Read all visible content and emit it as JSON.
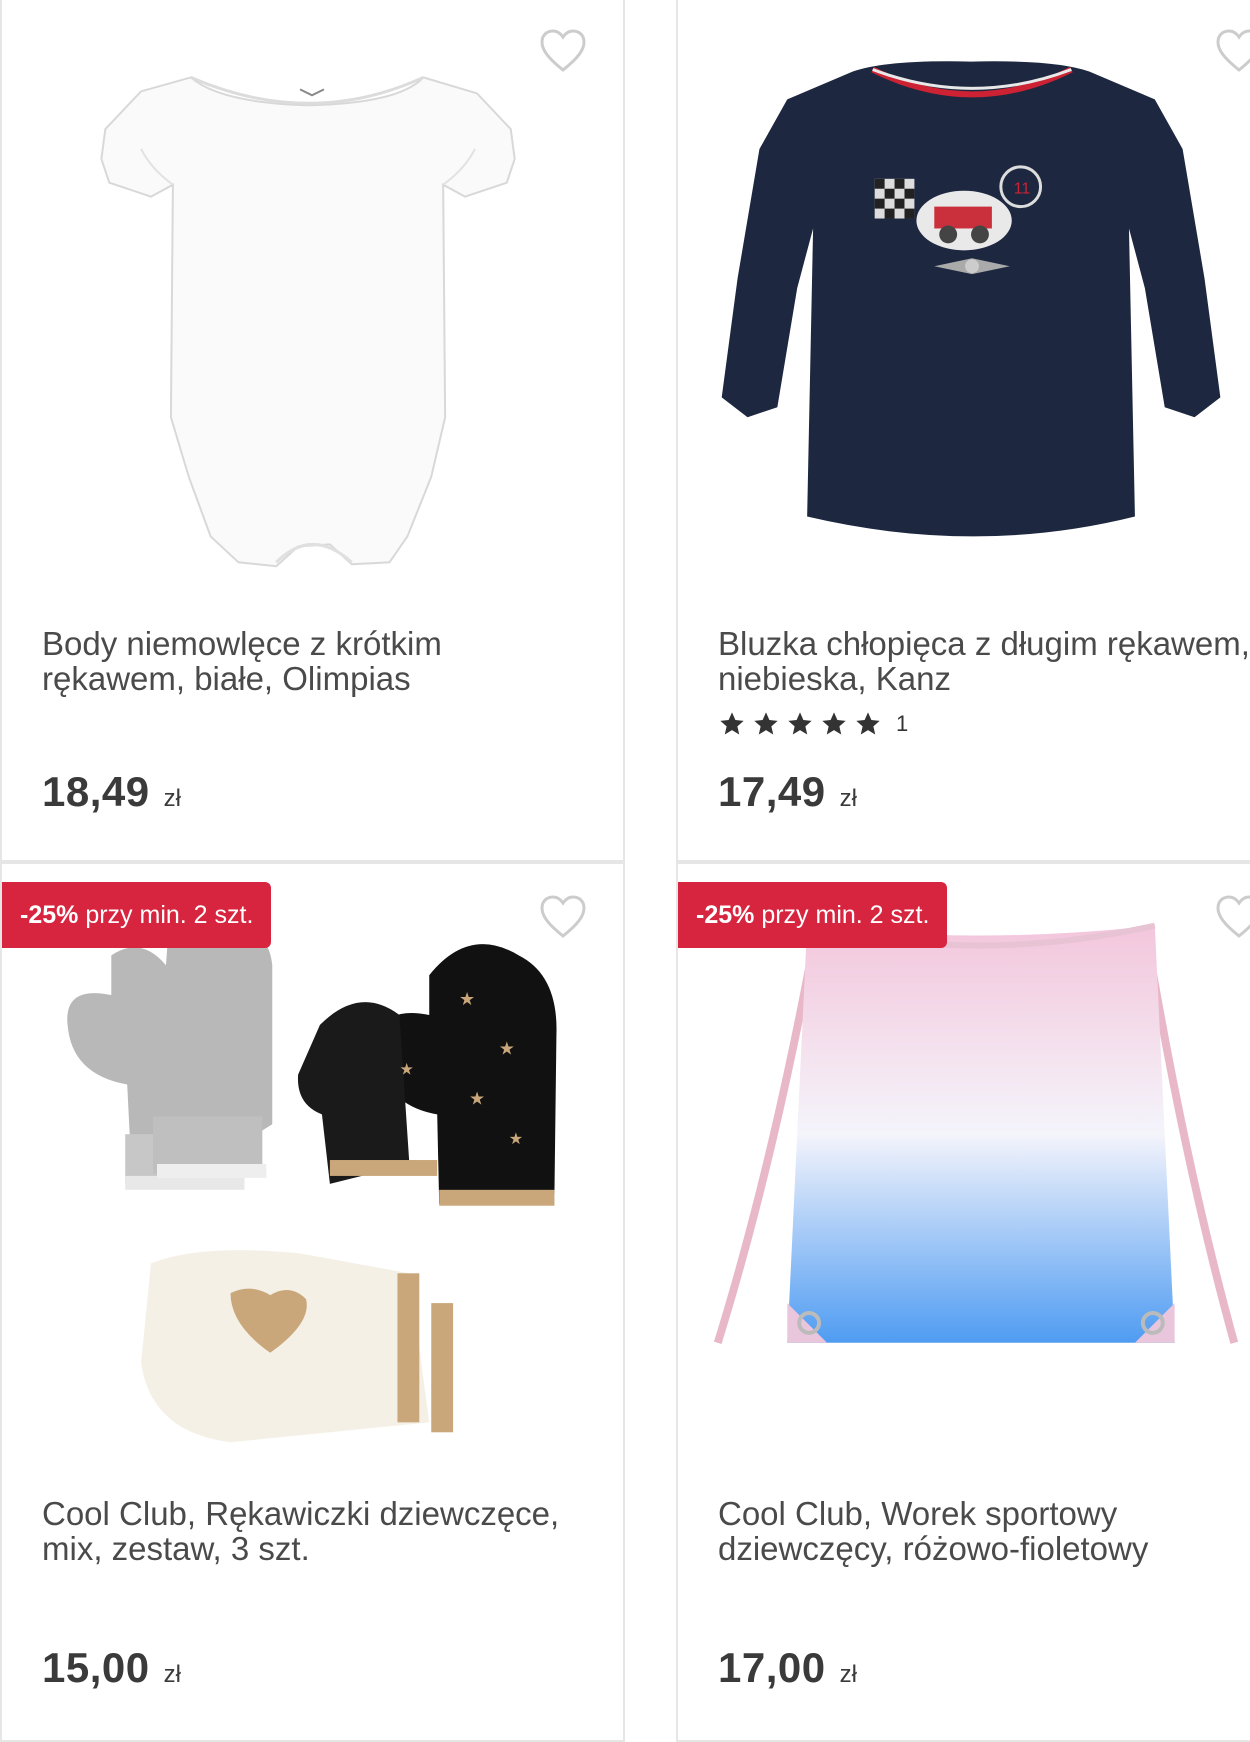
{
  "products": [
    {
      "name": "Body niemowlęce z krótkim rękawem, białe, Olimpias",
      "price": "18,49",
      "currency": "zł",
      "badge": null,
      "rating": null
    },
    {
      "name": "Bluzka chłopięca z długim rękawem, niebieska, Kanz",
      "price": "17,49",
      "currency": "zł",
      "badge": null,
      "rating": {
        "stars": 5,
        "count": "1"
      }
    },
    {
      "name": "Cool Club, Rękawiczki dziewczęce, mix, zestaw, 3 szt.",
      "price": "15,00",
      "currency": "zł",
      "badge": {
        "discount": "-25%",
        "text": " przy min. 2 szt."
      },
      "rating": null
    },
    {
      "name": "Cool Club, Worek sportowy dziewczęcy, różowo-fioletowy",
      "price": "17,00",
      "currency": "zł",
      "badge": {
        "discount": "-25%",
        "text": " przy min. 2 szt."
      },
      "rating": null
    }
  ],
  "icons": {
    "favorite": "heart-outline-icon",
    "star": "star-icon"
  },
  "colors": {
    "badge": "#d8253f",
    "heart": "#cccccc",
    "star": "#333333"
  }
}
